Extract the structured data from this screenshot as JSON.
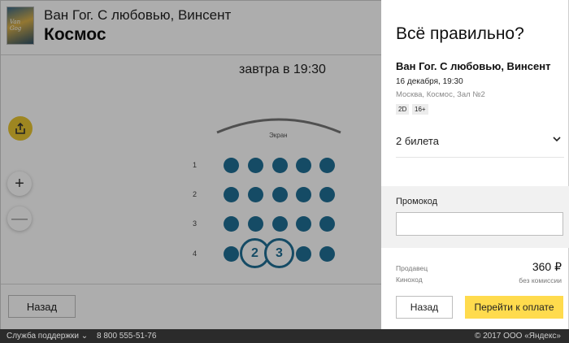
{
  "header": {
    "movie_title": "Ван Гог. С любовью, Винсент",
    "cinema": "Космос",
    "poster_text": "Van Gog"
  },
  "session": {
    "time": "завтра в 19:30"
  },
  "hall": {
    "screen_label": "Экран",
    "rows": [
      "1",
      "2",
      "3",
      "4"
    ],
    "selected_seats": [
      "2",
      "3"
    ],
    "seat_color": "#1f6f96"
  },
  "controls": {
    "zoom_in": "+",
    "zoom_out": "—"
  },
  "nav": {
    "back": "Назад"
  },
  "footer": {
    "support": "Служба поддержки",
    "phone": "8 800 555-51-76",
    "copyright": "© 2017 ООО «Яндекс»"
  },
  "panel": {
    "title": "Всё правильно?",
    "movie": "Ван Гог. С любовью, Винсент",
    "datetime": "16 декабря, 19:30",
    "place": "Москва, Космос, Зал №2",
    "tags": [
      "2D",
      "16+"
    ],
    "tickets": "2 билета",
    "promo_label": "Промокод",
    "promo_value": "",
    "seller_label": "Продавец",
    "seller": "Киноход",
    "price": "360 ₽",
    "commission": "без комиссии",
    "back": "Назад",
    "pay": "Перейти к оплате",
    "pay_color": "#ffdb4d"
  }
}
